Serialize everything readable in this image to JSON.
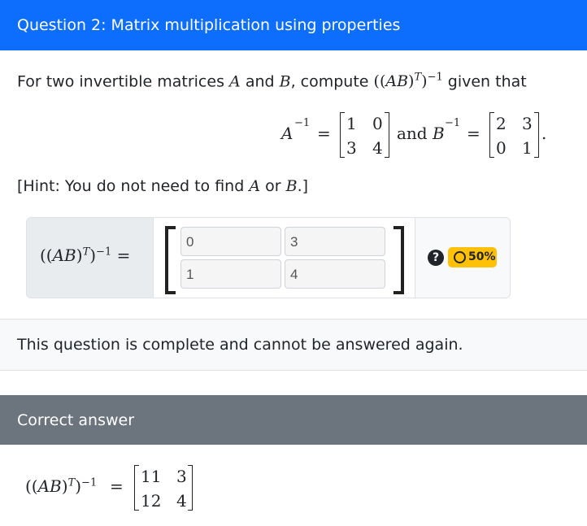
{
  "header": {
    "title": "Question 2: Matrix multiplication using properties"
  },
  "question": {
    "intro_before_A": "For two invertible matrices",
    "A": "A",
    "and_word": "and",
    "B": "B",
    "compute_word": ", compute",
    "given_that": "given that",
    "expr_open": "((",
    "expr_AB": "AB",
    "expr_close": ")",
    "sup_T": "T",
    "expr_paren": ")",
    "sup_inv": "−1",
    "A_inv_matrix": [
      [
        "1",
        "0"
      ],
      [
        "3",
        "4"
      ]
    ],
    "B_inv_matrix": [
      [
        "2",
        "3"
      ],
      [
        "0",
        "1"
      ]
    ],
    "eq_and": "and",
    "eq_equals": "=",
    "period": "."
  },
  "hint": {
    "prefix": "[Hint: You do not need to find",
    "A": "A",
    "or_word": "or",
    "B": "B",
    "suffix": ".]"
  },
  "answer_input": {
    "cells": [
      [
        "0",
        "3"
      ],
      [
        "1",
        "4"
      ]
    ],
    "score_label": "50%",
    "help_label": "?"
  },
  "status": {
    "message": "This question is complete and cannot be answered again."
  },
  "correct": {
    "header": "Correct answer",
    "matrix": [
      [
        "11",
        "3"
      ],
      [
        "12",
        "4"
      ]
    ]
  }
}
